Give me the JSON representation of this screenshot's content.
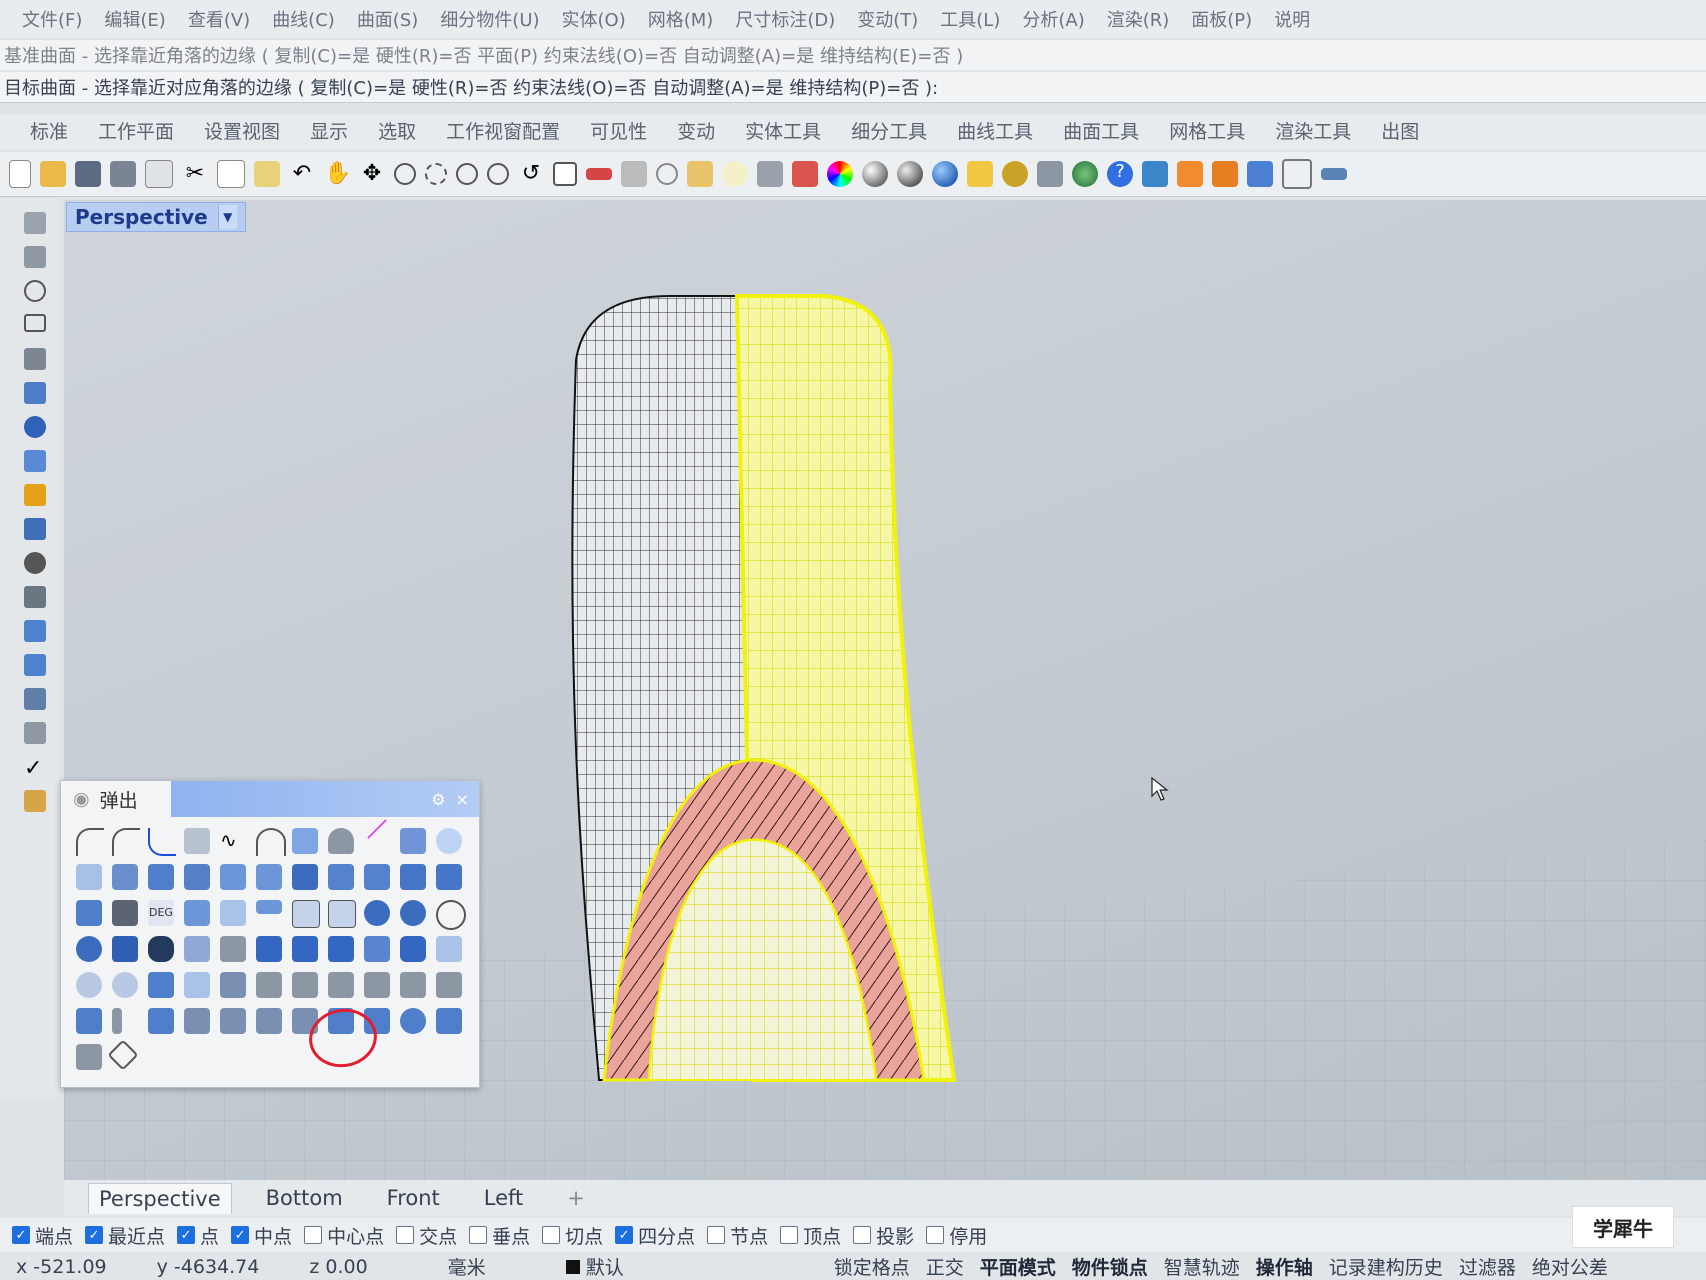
{
  "menu": [
    "文件(F)",
    "编辑(E)",
    "查看(V)",
    "曲线(C)",
    "曲面(S)",
    "细分物件(U)",
    "实体(O)",
    "网格(M)",
    "尺寸标注(D)",
    "变动(T)",
    "工具(L)",
    "分析(A)",
    "渲染(R)",
    "面板(P)",
    "说明"
  ],
  "command": {
    "line1": "基准曲面 - 选择靠近角落的边缘 ( 复制(C)=是  硬性(R)=否  平面(P)  约束法线(O)=否  自动调整(A)=是  维持结构(E)=否 )",
    "line2": "目标曲面 - 选择靠近对应角落的边缘 ( 复制(C)=是  硬性(R)=否  约束法线(O)=否  自动调整(A)=是  维持结构(P)=否 ):"
  },
  "tabs": [
    "标准",
    "工作平面",
    "设置视图",
    "显示",
    "选取",
    "工作视窗配置",
    "可见性",
    "变动",
    "实体工具",
    "细分工具",
    "曲线工具",
    "曲面工具",
    "网格工具",
    "渲染工具",
    "出图"
  ],
  "viewport": {
    "title": "Perspective",
    "dropdown_icon": "chevron-down-icon"
  },
  "popup": {
    "title": "弹出",
    "settings_icon": "gear-icon",
    "close_label": "×"
  },
  "view_tabs": [
    "Perspective",
    "Bottom",
    "Front",
    "Left"
  ],
  "add_tab_label": "+",
  "snaps": [
    {
      "label": "端点",
      "on": true
    },
    {
      "label": "最近点",
      "on": true
    },
    {
      "label": "点",
      "on": true
    },
    {
      "label": "中点",
      "on": true
    },
    {
      "label": "中心点",
      "on": false
    },
    {
      "label": "交点",
      "on": false
    },
    {
      "label": "垂点",
      "on": false
    },
    {
      "label": "切点",
      "on": false
    },
    {
      "label": "四分点",
      "on": true
    },
    {
      "label": "节点",
      "on": false
    },
    {
      "label": "顶点",
      "on": false
    },
    {
      "label": "投影",
      "on": false
    },
    {
      "label": "停用",
      "on": false
    }
  ],
  "status": {
    "x": "x -521.09",
    "y": "y -4634.74",
    "z": "z 0.00",
    "unit": "毫米",
    "layer": "默认",
    "modes": [
      "锁定格点",
      "正交",
      "平面模式",
      "物件锁点",
      "智慧轨迹",
      "操作轴",
      "记录建构历史",
      "过滤器",
      "绝对公差"
    ]
  },
  "watermark": "学犀牛"
}
